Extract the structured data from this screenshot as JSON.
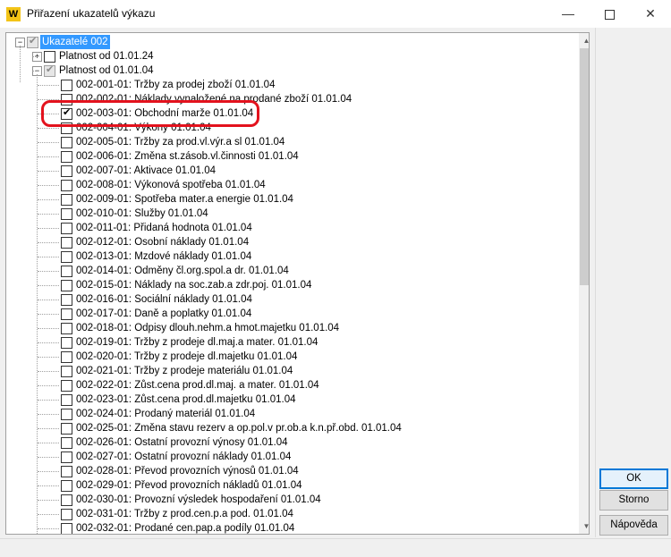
{
  "window": {
    "title": "Přiřazení ukazatelů výkazu",
    "app_icon_letter": "W",
    "minimize_glyph": "—",
    "close_glyph": "✕"
  },
  "tree": {
    "root": {
      "label": "Ukazatelé 002",
      "checked": "partial",
      "expanded": true,
      "selected": true
    },
    "groups": [
      {
        "label": "Platnost od 01.01.24",
        "checked": false,
        "expanded": false
      },
      {
        "label": "Platnost od 01.01.04",
        "checked": "partial",
        "expanded": true
      }
    ],
    "items": [
      {
        "label": "002-001-01: Tržby za prodej zboží 01.01.04",
        "checked": false
      },
      {
        "label": "002-002-01: Náklady vynaložené na prodané zboží 01.01.04",
        "checked": false
      },
      {
        "label": "002-003-01: Obchodní marže 01.01.04",
        "checked": true
      },
      {
        "label": "002-004-01: Výkony 01.01.04",
        "checked": false
      },
      {
        "label": "002-005-01: Tržby za prod.vl.výr.a sl 01.01.04",
        "checked": false
      },
      {
        "label": "002-006-01: Změna st.zásob.vl.činnosti 01.01.04",
        "checked": false
      },
      {
        "label": "002-007-01: Aktivace 01.01.04",
        "checked": false
      },
      {
        "label": "002-008-01: Výkonová spotřeba 01.01.04",
        "checked": false
      },
      {
        "label": "002-009-01: Spotřeba mater.a energie 01.01.04",
        "checked": false
      },
      {
        "label": "002-010-01: Služby 01.01.04",
        "checked": false
      },
      {
        "label": "002-011-01: Přidaná hodnota 01.01.04",
        "checked": false
      },
      {
        "label": "002-012-01: Osobní náklady 01.01.04",
        "checked": false
      },
      {
        "label": "002-013-01: Mzdové náklady 01.01.04",
        "checked": false
      },
      {
        "label": "002-014-01: Odměny čl.org.spol.a dr. 01.01.04",
        "checked": false
      },
      {
        "label": "002-015-01: Náklady na soc.zab.a zdr.poj. 01.01.04",
        "checked": false
      },
      {
        "label": "002-016-01: Sociální náklady 01.01.04",
        "checked": false
      },
      {
        "label": "002-017-01: Daně a poplatky 01.01.04",
        "checked": false
      },
      {
        "label": "002-018-01: Odpisy dlouh.nehm.a hmot.majetku 01.01.04",
        "checked": false
      },
      {
        "label": "002-019-01: Tržby z prodeje dl.maj.a mater. 01.01.04",
        "checked": false
      },
      {
        "label": "002-020-01: Tržby z prodeje dl.majetku 01.01.04",
        "checked": false
      },
      {
        "label": "002-021-01: Tržby z prodeje materiálu 01.01.04",
        "checked": false
      },
      {
        "label": "002-022-01: Zůst.cena prod.dl.maj. a mater. 01.01.04",
        "checked": false
      },
      {
        "label": "002-023-01: Zůst.cena prod.dl.majetku 01.01.04",
        "checked": false
      },
      {
        "label": "002-024-01: Prodaný materiál 01.01.04",
        "checked": false
      },
      {
        "label": "002-025-01: Změna stavu rezerv a op.pol.v pr.ob.a k.n.př.obd. 01.01.04",
        "checked": false
      },
      {
        "label": "002-026-01: Ostatní provozní výnosy 01.01.04",
        "checked": false
      },
      {
        "label": "002-027-01: Ostatní provozní náklady 01.01.04",
        "checked": false
      },
      {
        "label": "002-028-01: Převod provozních výnosů 01.01.04",
        "checked": false
      },
      {
        "label": "002-029-01: Převod provozních nákladů 01.01.04",
        "checked": false
      },
      {
        "label": "002-030-01: Provozní výsledek hospodaření 01.01.04",
        "checked": false
      },
      {
        "label": "002-031-01: Tržby z prod.cen.p.a pod. 01.01.04",
        "checked": false
      },
      {
        "label": "002-032-01: Prodané cen.pap.a podíly 01.01.04",
        "checked": false
      }
    ]
  },
  "buttons": {
    "ok": "OK",
    "cancel": "Storno",
    "help": "Nápověda"
  }
}
